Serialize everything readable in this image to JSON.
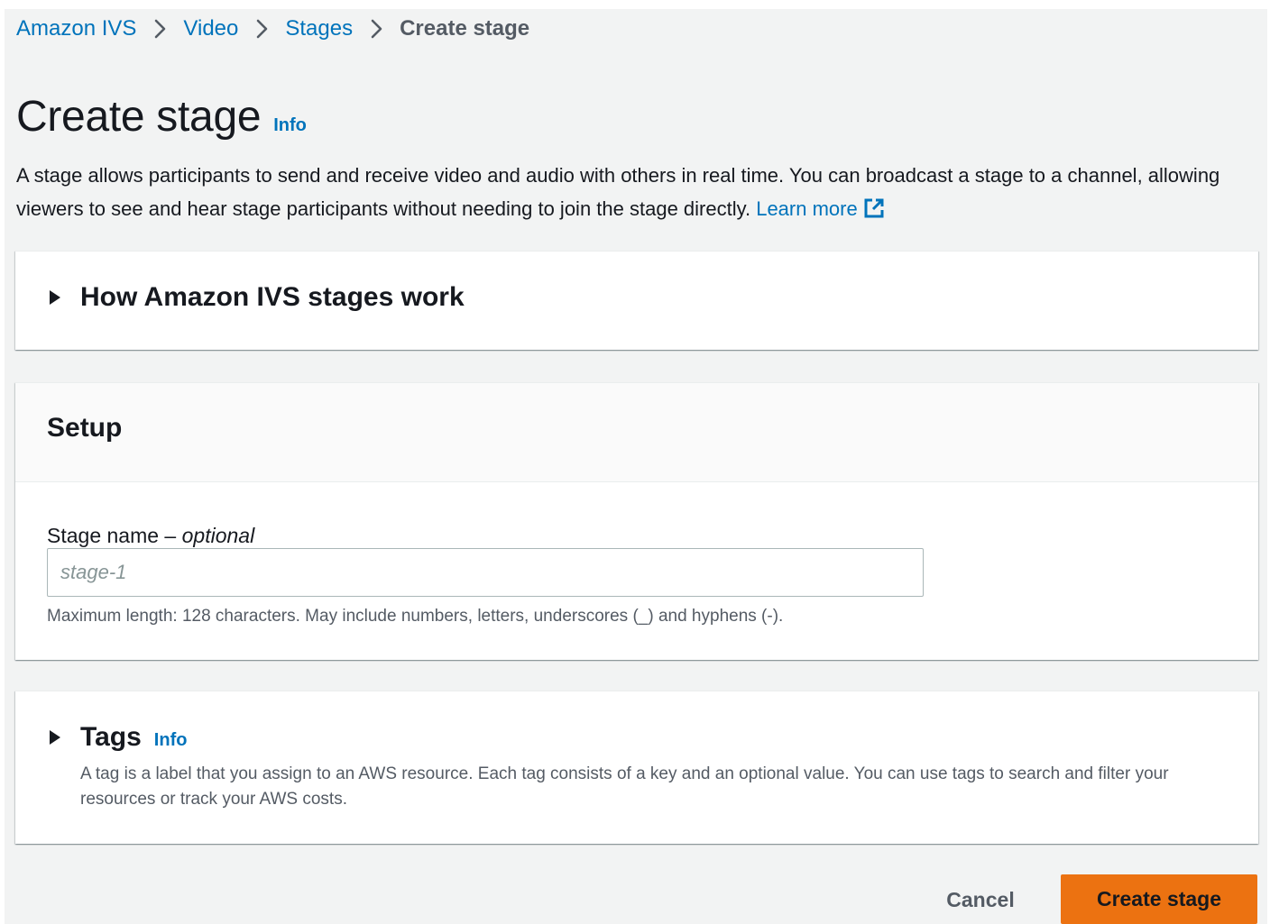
{
  "breadcrumb": {
    "items": [
      "Amazon IVS",
      "Video",
      "Stages"
    ],
    "current": "Create stage"
  },
  "header": {
    "title": "Create stage",
    "info": "Info",
    "description": "A stage allows participants to send and receive video and audio with others in real time. You can broadcast a stage to a channel, allowing viewers to see and hear stage participants without needing to join the stage directly.",
    "learn_more": "Learn more"
  },
  "how_it_works": {
    "title": "How Amazon IVS stages work"
  },
  "setup": {
    "title": "Setup",
    "stage_name_label": "Stage name",
    "label_separator": " – ",
    "optional": "optional",
    "stage_name_placeholder": "stage-1",
    "constraint": "Maximum length: 128 characters. May include numbers, letters, underscores (_) and hyphens (-)."
  },
  "tags": {
    "title": "Tags",
    "info": "Info",
    "description": "A tag is a label that you assign to an AWS resource. Each tag consists of a key and an optional value. You can use tags to search and filter your resources or track your AWS costs."
  },
  "footer": {
    "cancel_label": "Cancel",
    "create_label": "Create stage"
  },
  "colors": {
    "link": "#0073bb",
    "primary_button": "#ec7211",
    "text": "#16191f",
    "secondary_text": "#545b64",
    "page_background": "#f2f3f3"
  },
  "icons": {
    "breadcrumb_separator": "chevron-right-icon",
    "external_link": "external-link-icon",
    "expand": "caret-right-icon"
  }
}
